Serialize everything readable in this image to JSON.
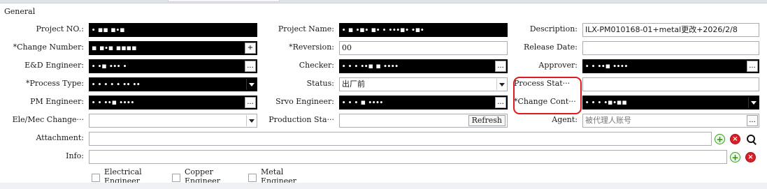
{
  "section": {
    "title": "General"
  },
  "labels": {
    "project_no": "Project NO.:",
    "change_number": "*Change Number:",
    "ed_engineer": "E&D Engineer:",
    "process_type": "*Process Type:",
    "pm_engineer": "PM Engineer:",
    "ele_mec_change": "Ele/Mec Change···",
    "attachment": "Attachment:",
    "info": "Info:",
    "project_name": "Project Name:",
    "reversion": "*Reversion:",
    "checker": "Checker:",
    "status": "Status:",
    "srvo_engineer": "Srvo Engineer:",
    "production_status": "Production Sta···",
    "description": "Description:",
    "release_date": "Release Date:",
    "approver": "Approver:",
    "process_status": "Process Stat···",
    "change_content": "*Change Cont···",
    "agent": "Agent:"
  },
  "values": {
    "project_no": "∙ ▪▪ ▪∙▪",
    "project_name": "∙ ▪ ∙▪∙ ▪∙ ∙ ∙∙∙▪∙ ∙▪∙",
    "description": "ILX-PM010168-01+metal更改+2026/2/8",
    "change_number": "▪ ▪∙▪ ▪▪▪▪",
    "reversion": "00",
    "release_date": "",
    "ed_engineer": "∙ ∙▪ ∙∙∙ ∙",
    "checker": "∙ ∙ ∙ ∙∙▪ ▪ ∙∙∙∙",
    "approver": "∙ ∙ ∙∙▪ ∙∙∙∙",
    "process_type": "∙ ∙ ∙ ∙ ∙ ∙∙ ∙∙",
    "status": "出厂前",
    "process_status": "",
    "pm_engineer": "∙ ∙ ∙∙▪ ∙∙∙∙",
    "srvo_engineer": "∙ ∙ ∙ ▪ ∙∙∙∙",
    "change_content": "∙ ∙ ∙ ∙▪∙▪▪",
    "ele_mec_change": "",
    "production_status": "",
    "agent_placeholder": "被代理人账号",
    "attachment": "",
    "info": ""
  },
  "buttons": {
    "ellipsis": "...",
    "plus": "+",
    "refresh": "Refresh",
    "add": "+",
    "delete": "×"
  },
  "checkboxes": [
    {
      "label": "Electrical Engineer",
      "checked": false
    },
    {
      "label": "Copper Engineer",
      "checked": false
    },
    {
      "label": "Metal Engineer",
      "checked": false
    }
  ],
  "icons": {
    "add": "add-circle-icon",
    "delete": "delete-circle-icon",
    "search": "search-icon",
    "dropdown": "chevron-down-icon",
    "ellipsis": "ellipsis-icon"
  },
  "colors": {
    "highlight": "#e0191d",
    "redacted": "#000000",
    "add_green": "#3d9a26",
    "delete_red": "#d81f26"
  }
}
